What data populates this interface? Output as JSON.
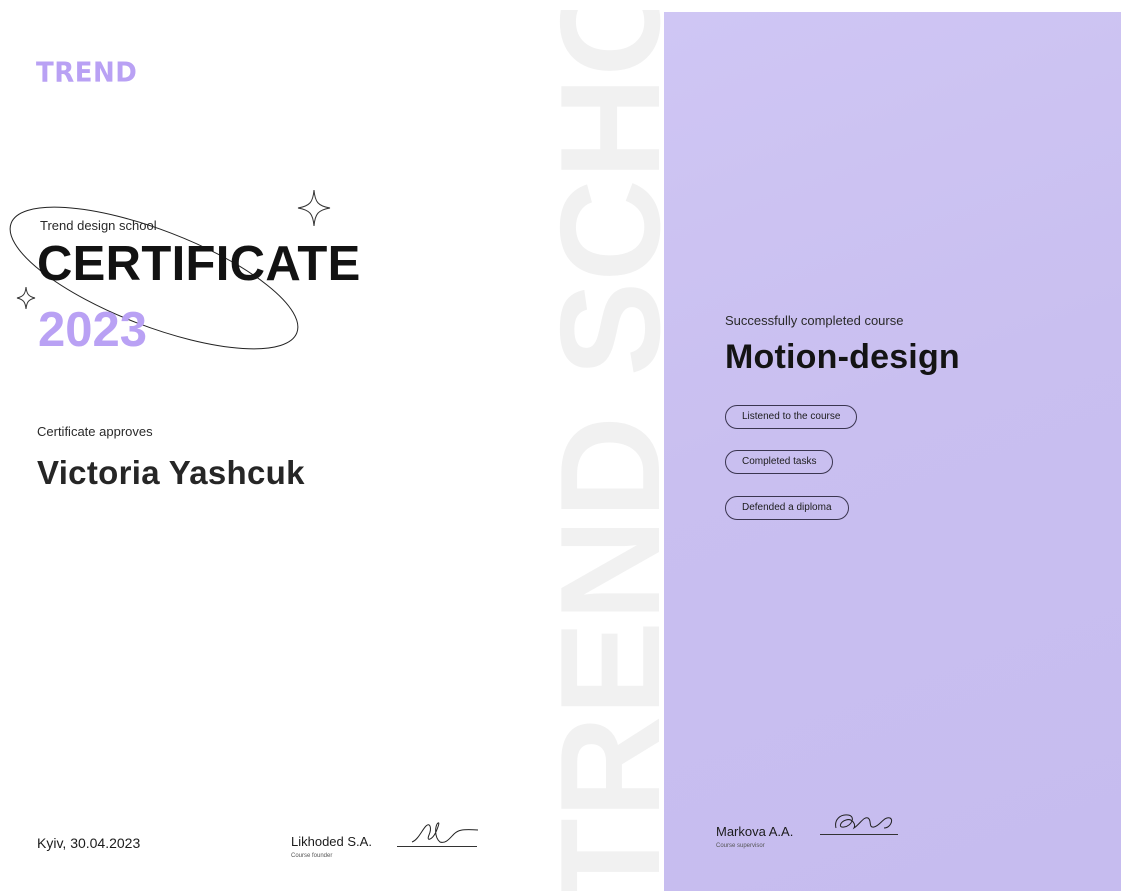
{
  "logo": {
    "text": "TREND"
  },
  "certificate": {
    "school": "Trend design school",
    "title": "CERTIFICATE",
    "year": "2023",
    "approves_label": "Certificate approves",
    "recipient": "Victoria Yashcuk",
    "place_date": "Kyiv, 30.04.2023"
  },
  "watermark": {
    "text": "TREND SCHOOL"
  },
  "course": {
    "completed_label": "Successfully completed course",
    "name": "Motion-design",
    "achievements": [
      {
        "label": "Listened to the course"
      },
      {
        "label": "Completed tasks"
      },
      {
        "label": "Defended a diploma"
      }
    ]
  },
  "signatures": {
    "founder": {
      "name": "Likhoded S.A.",
      "role": "Course founder"
    },
    "supervisor": {
      "name": "Markova A.A.",
      "role": "Course supervisor"
    }
  },
  "colors": {
    "accent": "#b9a1f4",
    "panel": "#c9bff0",
    "watermark": "#f1f1f1",
    "text": "#121212"
  },
  "icons": [
    "sparkle-star-icon",
    "sparkle-star-icon",
    "orbit-ellipse-decoration",
    "handwritten-signature"
  ]
}
